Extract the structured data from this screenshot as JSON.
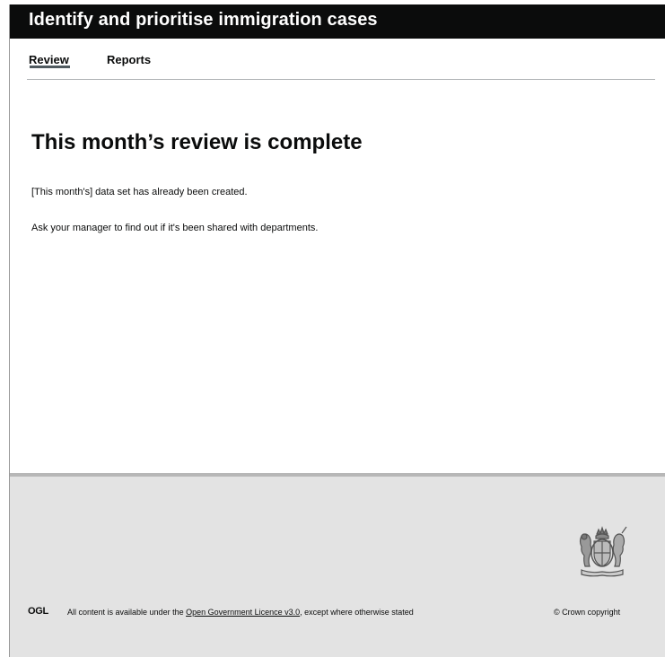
{
  "header": {
    "service_name": "Identify and prioritise immigration cases"
  },
  "nav": {
    "tabs": [
      {
        "label": "Review",
        "active": true
      },
      {
        "label": "Reports",
        "active": false
      }
    ]
  },
  "main": {
    "title": "This month’s review is complete",
    "paragraphs": [
      "[This month's] data set has already been created.",
      "Ask your manager to find out if it's been shared with departments."
    ]
  },
  "footer": {
    "ogl_logo": "OGL",
    "licence_prefix": "All content is available under the ",
    "licence_link": "Open Government Licence v3.0",
    "licence_suffix": ", except where otherwise stated",
    "copyright": "© Crown copyright"
  },
  "colors": {
    "header_bg": "#0b0c0c",
    "footer_bg": "#e3e3e3",
    "text": "#0b0c0c"
  },
  "icons": {
    "crest": "royal-coat-of-arms-icon"
  }
}
